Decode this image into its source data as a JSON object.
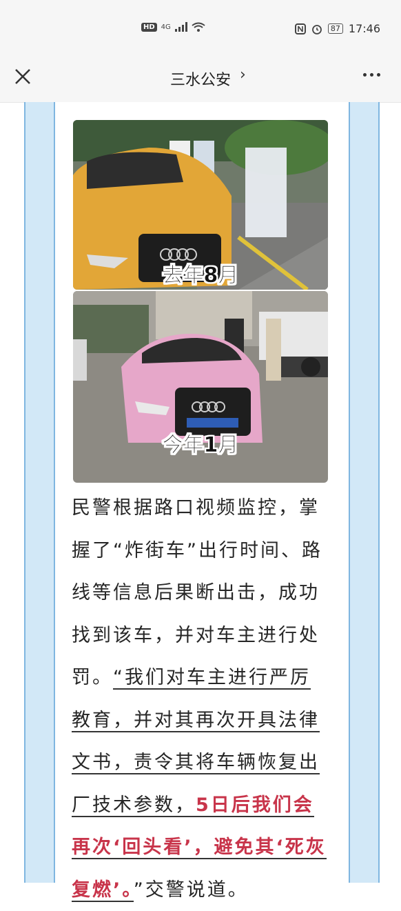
{
  "status_bar": {
    "network": "HD",
    "signal": "4G",
    "battery": "87",
    "time": "17:46"
  },
  "nav": {
    "title": "三水公安",
    "chevron": "›"
  },
  "photos": [
    {
      "label": "去年8月",
      "car_color": "#e2a637"
    },
    {
      "label": "今年1月",
      "car_color": "#e6a7c9"
    }
  ],
  "article": {
    "part1": "民警根据路口视频监控，掌握了“炸街车”出行时间、路线等信息后果断出击，成功找到该车，并对车主进行处罚。",
    "quote_open": "“我们对车主进行严厉教育，并对其再次开具法律文书，责令其将车辆恢复出厂技术参数，",
    "highlight": "5日后我们会再次‘回头看’，避免其‘死灰复燃’。",
    "quote_close": "”",
    "tail": "交警说道。"
  },
  "colors": {
    "accent_red": "#c8344a",
    "frame_blue": "#d2e8f7"
  }
}
